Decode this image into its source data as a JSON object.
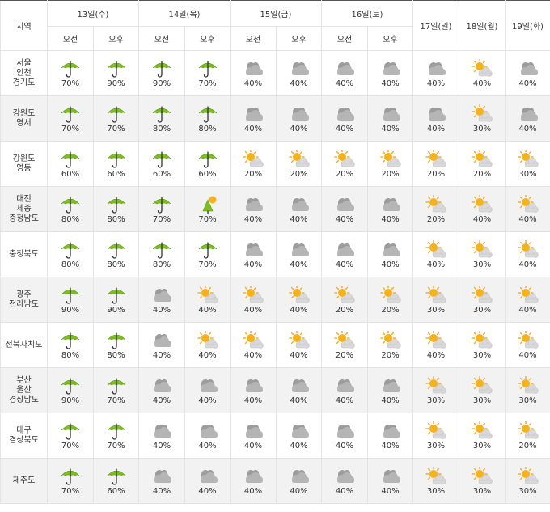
{
  "header": {
    "region_label": "지역",
    "days": [
      "13일(수)",
      "14일(목)",
      "15일(금)",
      "16일(토)"
    ],
    "single_days": [
      "17일(일)",
      "18일(월)",
      "19일(화)"
    ],
    "am_label": "오전",
    "pm_label": "오후"
  },
  "icons": {
    "rain": "umbrella-icon",
    "rain_sun": "umbrella-sun-icon",
    "cloudy": "cloud-icon",
    "partly_cloudy": "sun-cloud-icon"
  },
  "colors": {
    "umbrella": "#7dbd1e",
    "cloud": "#b5b5b5",
    "sun": "#f6b21a"
  },
  "rows": [
    {
      "region": [
        "서울",
        "인천",
        "경기도"
      ],
      "cells": [
        [
          "rain",
          "70%"
        ],
        [
          "rain",
          "90%"
        ],
        [
          "rain",
          "90%"
        ],
        [
          "rain",
          "70%"
        ],
        [
          "cloudy",
          "40%"
        ],
        [
          "cloudy",
          "40%"
        ],
        [
          "cloudy",
          "40%"
        ],
        [
          "cloudy",
          "40%"
        ],
        [
          "cloudy",
          "40%"
        ],
        [
          "partly_cloudy",
          "40%"
        ],
        [
          "cloudy",
          "40%"
        ]
      ]
    },
    {
      "region": [
        "강원도",
        "영서"
      ],
      "cells": [
        [
          "rain",
          "70%"
        ],
        [
          "rain",
          "70%"
        ],
        [
          "rain",
          "80%"
        ],
        [
          "rain",
          "80%"
        ],
        [
          "cloudy",
          "40%"
        ],
        [
          "cloudy",
          "40%"
        ],
        [
          "cloudy",
          "40%"
        ],
        [
          "cloudy",
          "40%"
        ],
        [
          "cloudy",
          "40%"
        ],
        [
          "partly_cloudy",
          "30%"
        ],
        [
          "cloudy",
          "40%"
        ]
      ]
    },
    {
      "region": [
        "강원도",
        "영동"
      ],
      "cells": [
        [
          "rain",
          "60%"
        ],
        [
          "rain",
          "60%"
        ],
        [
          "rain",
          "60%"
        ],
        [
          "rain",
          "60%"
        ],
        [
          "partly_cloudy",
          "20%"
        ],
        [
          "partly_cloudy",
          "20%"
        ],
        [
          "partly_cloudy",
          "20%"
        ],
        [
          "partly_cloudy",
          "20%"
        ],
        [
          "partly_cloudy",
          "20%"
        ],
        [
          "partly_cloudy",
          "20%"
        ],
        [
          "partly_cloudy",
          "30%"
        ]
      ]
    },
    {
      "region": [
        "대전",
        "세종",
        "충청남도"
      ],
      "cells": [
        [
          "rain",
          "80%"
        ],
        [
          "rain",
          "80%"
        ],
        [
          "rain",
          "70%"
        ],
        [
          "rain_sun",
          "70%"
        ],
        [
          "cloudy",
          "40%"
        ],
        [
          "cloudy",
          "40%"
        ],
        [
          "cloudy",
          "40%"
        ],
        [
          "cloudy",
          "40%"
        ],
        [
          "partly_cloudy",
          "20%"
        ],
        [
          "partly_cloudy",
          "40%"
        ],
        [
          "partly_cloudy",
          "40%"
        ]
      ]
    },
    {
      "region": [
        "충청북도"
      ],
      "cells": [
        [
          "rain",
          "80%"
        ],
        [
          "rain",
          "80%"
        ],
        [
          "rain",
          "80%"
        ],
        [
          "rain",
          "70%"
        ],
        [
          "cloudy",
          "40%"
        ],
        [
          "cloudy",
          "40%"
        ],
        [
          "cloudy",
          "40%"
        ],
        [
          "cloudy",
          "40%"
        ],
        [
          "partly_cloudy",
          "40%"
        ],
        [
          "partly_cloudy",
          "30%"
        ],
        [
          "partly_cloudy",
          "40%"
        ]
      ]
    },
    {
      "region": [
        "광주",
        "전라남도"
      ],
      "cells": [
        [
          "rain",
          "90%"
        ],
        [
          "rain",
          "90%"
        ],
        [
          "cloudy",
          "40%"
        ],
        [
          "partly_cloudy",
          "40%"
        ],
        [
          "partly_cloudy",
          "40%"
        ],
        [
          "partly_cloudy",
          "40%"
        ],
        [
          "partly_cloudy",
          "20%"
        ],
        [
          "partly_cloudy",
          "20%"
        ],
        [
          "partly_cloudy",
          "30%"
        ],
        [
          "partly_cloudy",
          "30%"
        ],
        [
          "partly_cloudy",
          "40%"
        ]
      ]
    },
    {
      "region": [
        "전북자치도"
      ],
      "cells": [
        [
          "rain",
          "80%"
        ],
        [
          "rain",
          "80%"
        ],
        [
          "cloudy",
          "40%"
        ],
        [
          "partly_cloudy",
          "40%"
        ],
        [
          "partly_cloudy",
          "40%"
        ],
        [
          "partly_cloudy",
          "40%"
        ],
        [
          "partly_cloudy",
          "20%"
        ],
        [
          "partly_cloudy",
          "20%"
        ],
        [
          "partly_cloudy",
          "40%"
        ],
        [
          "partly_cloudy",
          "30%"
        ],
        [
          "partly_cloudy",
          "40%"
        ]
      ]
    },
    {
      "region": [
        "부산",
        "울산",
        "경상남도"
      ],
      "cells": [
        [
          "rain",
          "90%"
        ],
        [
          "rain",
          "70%"
        ],
        [
          "cloudy",
          "40%"
        ],
        [
          "cloudy",
          "40%"
        ],
        [
          "cloudy",
          "40%"
        ],
        [
          "cloudy",
          "40%"
        ],
        [
          "cloudy",
          "40%"
        ],
        [
          "cloudy",
          "40%"
        ],
        [
          "partly_cloudy",
          "30%"
        ],
        [
          "partly_cloudy",
          "30%"
        ],
        [
          "partly_cloudy",
          "30%"
        ]
      ]
    },
    {
      "region": [
        "대구",
        "경상북도"
      ],
      "cells": [
        [
          "rain",
          "70%"
        ],
        [
          "rain",
          "70%"
        ],
        [
          "cloudy",
          "40%"
        ],
        [
          "cloudy",
          "40%"
        ],
        [
          "cloudy",
          "40%"
        ],
        [
          "cloudy",
          "40%"
        ],
        [
          "cloudy",
          "40%"
        ],
        [
          "cloudy",
          "40%"
        ],
        [
          "partly_cloudy",
          "30%"
        ],
        [
          "partly_cloudy",
          "30%"
        ],
        [
          "partly_cloudy",
          "20%"
        ]
      ]
    },
    {
      "region": [
        "제주도"
      ],
      "cells": [
        [
          "rain",
          "70%"
        ],
        [
          "rain",
          "60%"
        ],
        [
          "cloudy",
          "40%"
        ],
        [
          "cloudy",
          "40%"
        ],
        [
          "cloudy",
          "40%"
        ],
        [
          "cloudy",
          "40%"
        ],
        [
          "cloudy",
          "40%"
        ],
        [
          "cloudy",
          "40%"
        ],
        [
          "partly_cloudy",
          "30%"
        ],
        [
          "partly_cloudy",
          "30%"
        ],
        [
          "partly_cloudy",
          "30%"
        ]
      ]
    }
  ]
}
